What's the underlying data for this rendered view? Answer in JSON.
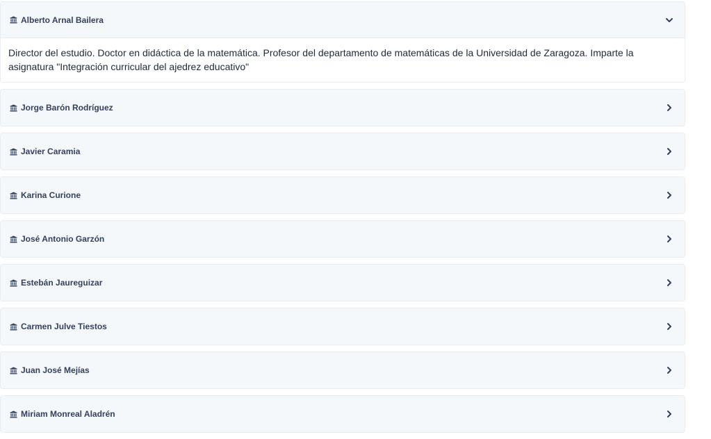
{
  "accordion": {
    "items": [
      {
        "name": "Alberto Arnal Bailera",
        "expanded": true,
        "description": "Director del estudio. Doctor en didáctica de la matemática. Profesor del departamento de matemáticas de la Universidad de Zaragoza. Imparte la asignatura \"Integración curricular del ajedrez educativo\""
      },
      {
        "name": "Jorge Barón Rodríguez",
        "expanded": false
      },
      {
        "name": "Javier Caramia",
        "expanded": false
      },
      {
        "name": "Karina Curione",
        "expanded": false
      },
      {
        "name": "José Antonio Garzón",
        "expanded": false
      },
      {
        "name": "Estebán Jaureguizar",
        "expanded": false
      },
      {
        "name": "Carmen Julve Tiestos",
        "expanded": false
      },
      {
        "name": "Juan José Mejías",
        "expanded": false
      },
      {
        "name": "Miriam Monreal Aladrén",
        "expanded": false
      }
    ],
    "icons": {
      "item_icon": "institution-icon",
      "expanded_icon": "chevron-down-icon",
      "collapsed_icon": "chevron-right-icon"
    },
    "colors": {
      "header_background": "#f5f8fa",
      "border": "#e8edf2",
      "title_text": "#33415e",
      "body_text": "#1f2937"
    }
  }
}
